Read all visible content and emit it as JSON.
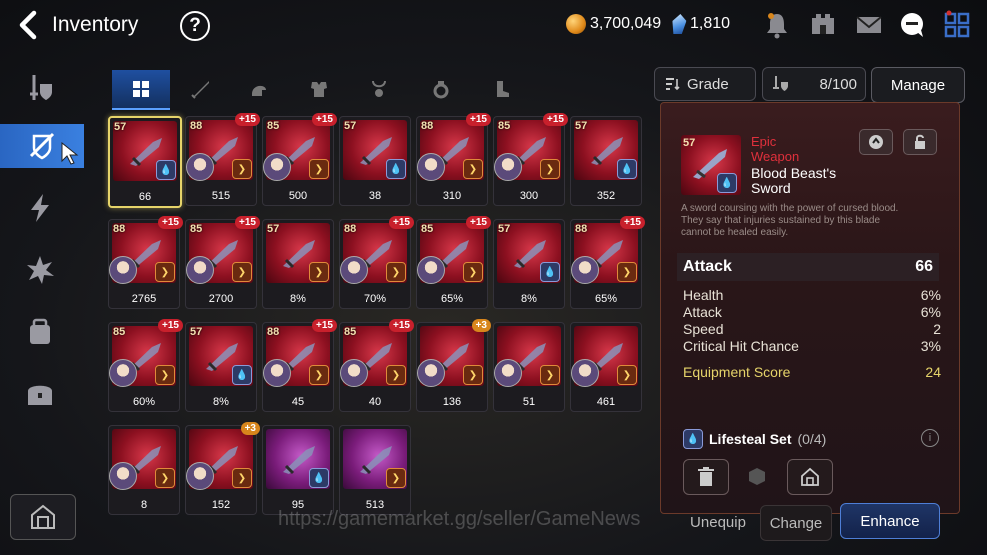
{
  "header": {
    "title": "Inventory"
  },
  "currency": {
    "gold": "3,700,049",
    "crystals": "1,810"
  },
  "sort": {
    "label": "Grade",
    "count": "8/100",
    "manage": "Manage"
  },
  "items": [
    {
      "lv": "57",
      "plus": "",
      "stat": "66",
      "sel": true,
      "avatar": false,
      "set": "blue"
    },
    {
      "lv": "88",
      "plus": "+15",
      "stat": "515",
      "avatar": true,
      "set": "orange"
    },
    {
      "lv": "85",
      "plus": "+15",
      "stat": "500",
      "avatar": true,
      "set": "orange"
    },
    {
      "lv": "57",
      "plus": "",
      "stat": "38",
      "avatar": false,
      "set": "blue"
    },
    {
      "lv": "88",
      "plus": "+15",
      "stat": "310",
      "avatar": true,
      "set": "orange"
    },
    {
      "lv": "85",
      "plus": "+15",
      "stat": "300",
      "avatar": true,
      "set": "orange"
    },
    {
      "lv": "57",
      "plus": "",
      "stat": "352",
      "avatar": false,
      "set": "blue"
    },
    {
      "lv": "88",
      "plus": "+15",
      "stat": "2765",
      "avatar": true,
      "set": "orange"
    },
    {
      "lv": "85",
      "plus": "+15",
      "stat": "2700",
      "avatar": true,
      "set": "orange"
    },
    {
      "lv": "57",
      "plus": "",
      "stat": "8%",
      "avatar": false,
      "set": "orange"
    },
    {
      "lv": "88",
      "plus": "+15",
      "stat": "70%",
      "avatar": true,
      "set": "orange"
    },
    {
      "lv": "85",
      "plus": "+15",
      "stat": "65%",
      "avatar": true,
      "set": "orange"
    },
    {
      "lv": "57",
      "plus": "",
      "stat": "8%",
      "avatar": false,
      "set": "blue"
    },
    {
      "lv": "88",
      "plus": "+15",
      "stat": "65%",
      "avatar": true,
      "set": "orange"
    },
    {
      "lv": "85",
      "plus": "+15",
      "stat": "60%",
      "avatar": true,
      "set": "orange"
    },
    {
      "lv": "57",
      "plus": "",
      "stat": "8%",
      "avatar": false,
      "set": "blue"
    },
    {
      "lv": "88",
      "plus": "+15",
      "stat": "45",
      "avatar": true,
      "set": "orange"
    },
    {
      "lv": "85",
      "plus": "+15",
      "stat": "40",
      "avatar": true,
      "set": "orange"
    },
    {
      "lv": "",
      "plus": "+3",
      "stat": "136",
      "avatar": true,
      "set": "orange",
      "gold": true
    },
    {
      "lv": "",
      "plus": "",
      "stat": "51",
      "avatar": true,
      "set": "orange"
    },
    {
      "lv": "",
      "plus": "",
      "stat": "461",
      "avatar": true,
      "set": "orange"
    },
    {
      "lv": "",
      "plus": "",
      "stat": "8",
      "avatar": true,
      "set": "orange"
    },
    {
      "lv": "",
      "plus": "+3",
      "stat": "152",
      "avatar": true,
      "set": "orange",
      "gold": true
    },
    {
      "lv": "",
      "plus": "",
      "stat": "95",
      "avatar": false,
      "set": "blue",
      "purple": true
    },
    {
      "lv": "",
      "plus": "",
      "stat": "513",
      "avatar": false,
      "set": "orange",
      "purple": true
    }
  ],
  "detail": {
    "level": "57",
    "grade": "Epic",
    "type": "Weapon",
    "name_line1": "Blood Beast's",
    "name_line2": "Sword",
    "desc_line1": "A sword coursing with the power of cursed blood.",
    "desc_line2": "They say that injuries sustained by this blade",
    "desc_line3": "cannot be healed easily.",
    "main_stat": {
      "label": "Attack",
      "value": "66"
    },
    "substats": [
      {
        "label": "Health",
        "value": "6%"
      },
      {
        "label": "Attack",
        "value": "6%"
      },
      {
        "label": "Speed",
        "value": "2"
      },
      {
        "label": "Critical Hit Chance",
        "value": "3%"
      }
    ],
    "score": {
      "label": "Equipment Score",
      "value": "24"
    },
    "set": {
      "label": "Lifesteal Set",
      "count": "(0/4)"
    }
  },
  "actions": {
    "unequip": "Unequip",
    "change": "Change",
    "enhance": "Enhance"
  },
  "watermark": "https://gamemarket.gg/seller/GameNews",
  "colors": {
    "accent": "#2a66c2",
    "grade_epic": "#e0303c",
    "score": "#e6d46a"
  }
}
